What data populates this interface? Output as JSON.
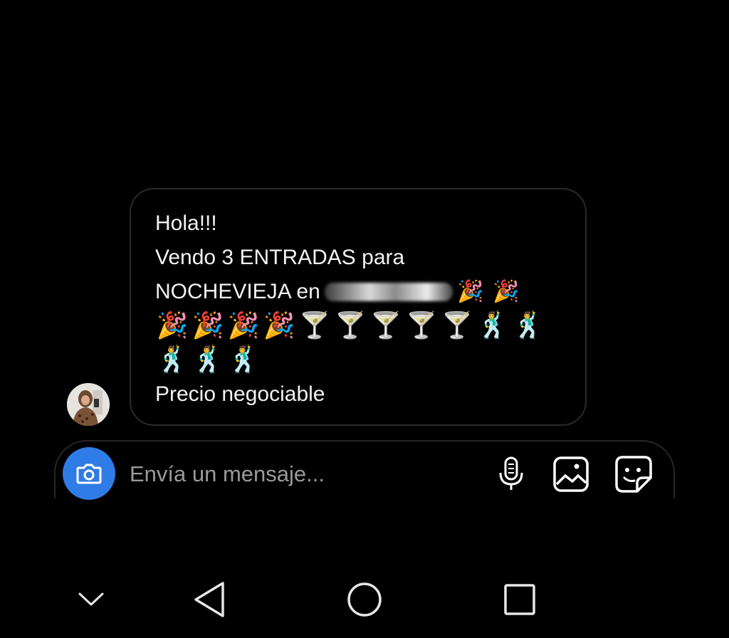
{
  "conversation": {
    "message": {
      "lines": [
        "Hola!!!",
        "Vendo 3 ENTRADAS para",
        "NOCHEVIEJA en",
        "Precio negociable"
      ],
      "emoji": {
        "line3_tail": [
          "🎉",
          "🎉"
        ],
        "line4": [
          "🎉",
          "🎉",
          "🎉",
          "🎉",
          "🍸",
          "🍸",
          "🍸",
          "🍸",
          "🍸",
          "🕺",
          "🕺"
        ],
        "line5": [
          "🕺",
          "🕺",
          "🕺"
        ]
      }
    },
    "avatar_icon": "profile-photo"
  },
  "composer": {
    "placeholder": "Envía un mensaje...",
    "icons": {
      "camera": "camera-icon",
      "mic": "microphone-icon",
      "gallery": "image-icon",
      "sticker": "sticker-icon"
    },
    "colors": {
      "camera_bg": "#2f7ce6",
      "border": "#262626"
    }
  },
  "navbar": {
    "icons": [
      "chevron-down-icon",
      "back-triangle-icon",
      "home-circle-icon",
      "recents-square-icon"
    ]
  }
}
